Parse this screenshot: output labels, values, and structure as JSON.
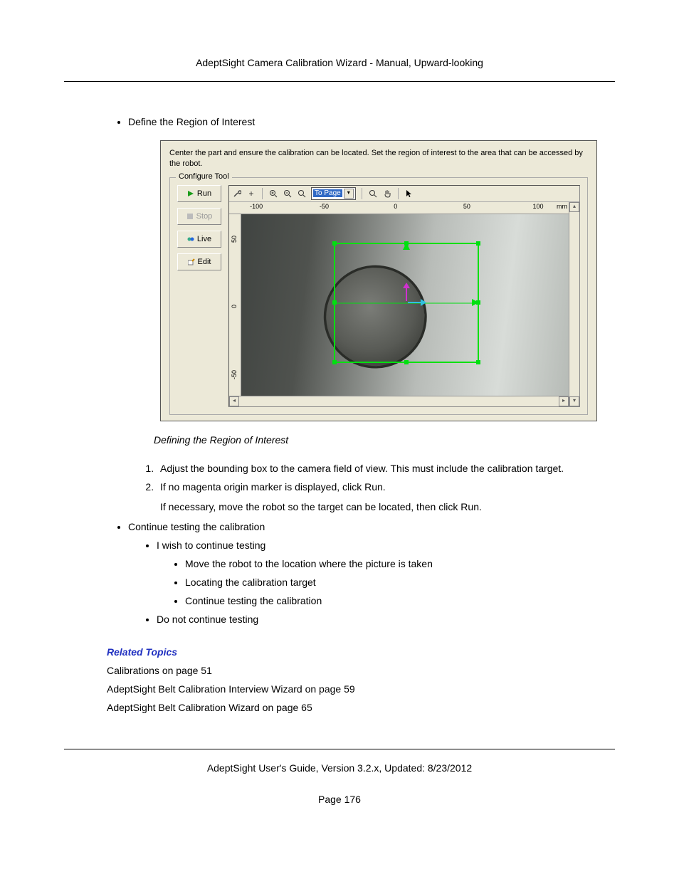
{
  "header": "AdeptSight Camera Calibration Wizard - Manual, Upward-looking",
  "bullet_roi": "Define the Region of Interest",
  "panel": {
    "instruction": "Center the part and ensure the calibration can be located. Set the region of interest to the area that can be accessed by the robot.",
    "fieldset": "Configure Tool",
    "buttons": {
      "run": "Run",
      "stop": "Stop",
      "live": "Live",
      "edit": "Edit"
    },
    "combo": "To Page",
    "ruler_unit": "mm",
    "ticks_x": {
      "n100": "-100",
      "n50": "-50",
      "zero": "0",
      "p50": "50",
      "p100": "100"
    },
    "ticks_y": {
      "p50": "50",
      "zero": "0",
      "n50": "-50"
    }
  },
  "caption": "Defining the Region of Interest",
  "steps": {
    "s1": "Adjust the bounding box to the camera field of view. This must include the calibration target.",
    "s2": "If no magenta origin marker is displayed, click Run.",
    "s2b": "If necessary, move the robot so the target can be located, then click Run."
  },
  "bullet_continue": "Continue testing the calibration",
  "sub": {
    "wish": "I wish to continue testing",
    "move": "Move the robot to the location where the picture is taken",
    "locate": "Locating the calibration target",
    "cont": "Continue testing the calibration",
    "not": "Do not continue testing"
  },
  "related": {
    "title": "Related Topics",
    "r1": "Calibrations on page 51",
    "r2": "AdeptSight Belt Calibration Interview Wizard on page 59",
    "r3": "AdeptSight Belt Calibration Wizard on page 65"
  },
  "footer": "AdeptSight User's Guide,  Version 3.2.x, Updated: 8/23/2012",
  "page_num": "Page 176"
}
